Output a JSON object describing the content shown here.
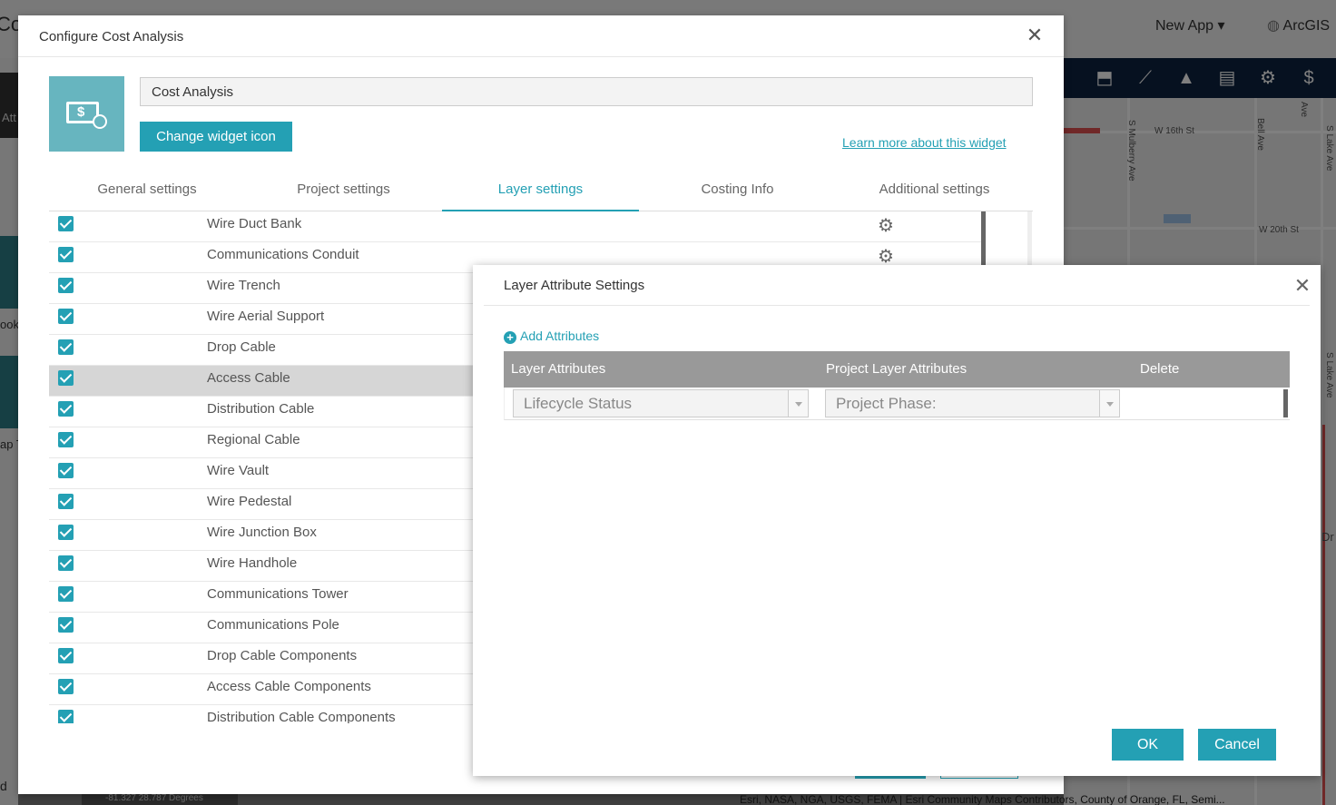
{
  "background": {
    "app_title": "Co",
    "new_app": "New App",
    "arcgis": "ArcGIS",
    "left_labels": [
      "Att",
      "ook",
      "ap T",
      "d"
    ],
    "map_labels": [
      "W 16th St",
      "W 20th St",
      "S Mulberry Ave",
      "Bell Ave",
      "Ave",
      "S Lake Ave",
      "S Lake Ave",
      "Dr"
    ],
    "coordinates": "-81.327 28.787 Degrees",
    "attribution": "Esri, NASA, NGA, USGS, FEMA | Esri Community Maps Contributors, County of Orange, FL, Semi...",
    "toolbar_icons": [
      "add-data-icon",
      "measure-icon",
      "education-icon",
      "print-icon",
      "settings-icon",
      "cost-icon"
    ]
  },
  "dialog": {
    "title": "Configure Cost Analysis",
    "widget_name_value": "Cost Analysis",
    "change_icon_label": "Change widget icon",
    "learn_more_label": "Learn more about this widget",
    "tabs": [
      {
        "label": "General settings"
      },
      {
        "label": "Project settings"
      },
      {
        "label": "Layer settings"
      },
      {
        "label": "Costing Info"
      },
      {
        "label": "Additional settings"
      }
    ],
    "active_tab": "Layer settings",
    "layers": [
      {
        "label": "Wire Duct Bank"
      },
      {
        "label": "Communications Conduit"
      },
      {
        "label": "Wire Trench"
      },
      {
        "label": "Wire Aerial Support"
      },
      {
        "label": "Drop Cable"
      },
      {
        "label": "Access Cable"
      },
      {
        "label": "Distribution Cable"
      },
      {
        "label": "Regional Cable"
      },
      {
        "label": "Wire Vault"
      },
      {
        "label": "Wire Pedestal"
      },
      {
        "label": "Wire Junction Box"
      },
      {
        "label": "Wire Handhole"
      },
      {
        "label": "Communications Tower"
      },
      {
        "label": "Communications Pole"
      },
      {
        "label": "Drop Cable Components"
      },
      {
        "label": "Access Cable Components"
      },
      {
        "label": "Distribution Cable Components"
      }
    ],
    "selected_layer": "Access Cable"
  },
  "popup": {
    "title": "Layer Attribute Settings",
    "add_attributes_label": "Add Attributes",
    "columns": {
      "layer_attributes": "Layer Attributes",
      "project_layer_attributes": "Project Layer Attributes",
      "delete": "Delete"
    },
    "rows": [
      {
        "layer_attribute": "Lifecycle Status",
        "project_attribute": "Project Phase:"
      }
    ],
    "ok_label": "OK",
    "cancel_label": "Cancel"
  },
  "colors": {
    "accent": "#24a0b4",
    "table_header": "#999999",
    "toolbar": "#0d2340"
  }
}
